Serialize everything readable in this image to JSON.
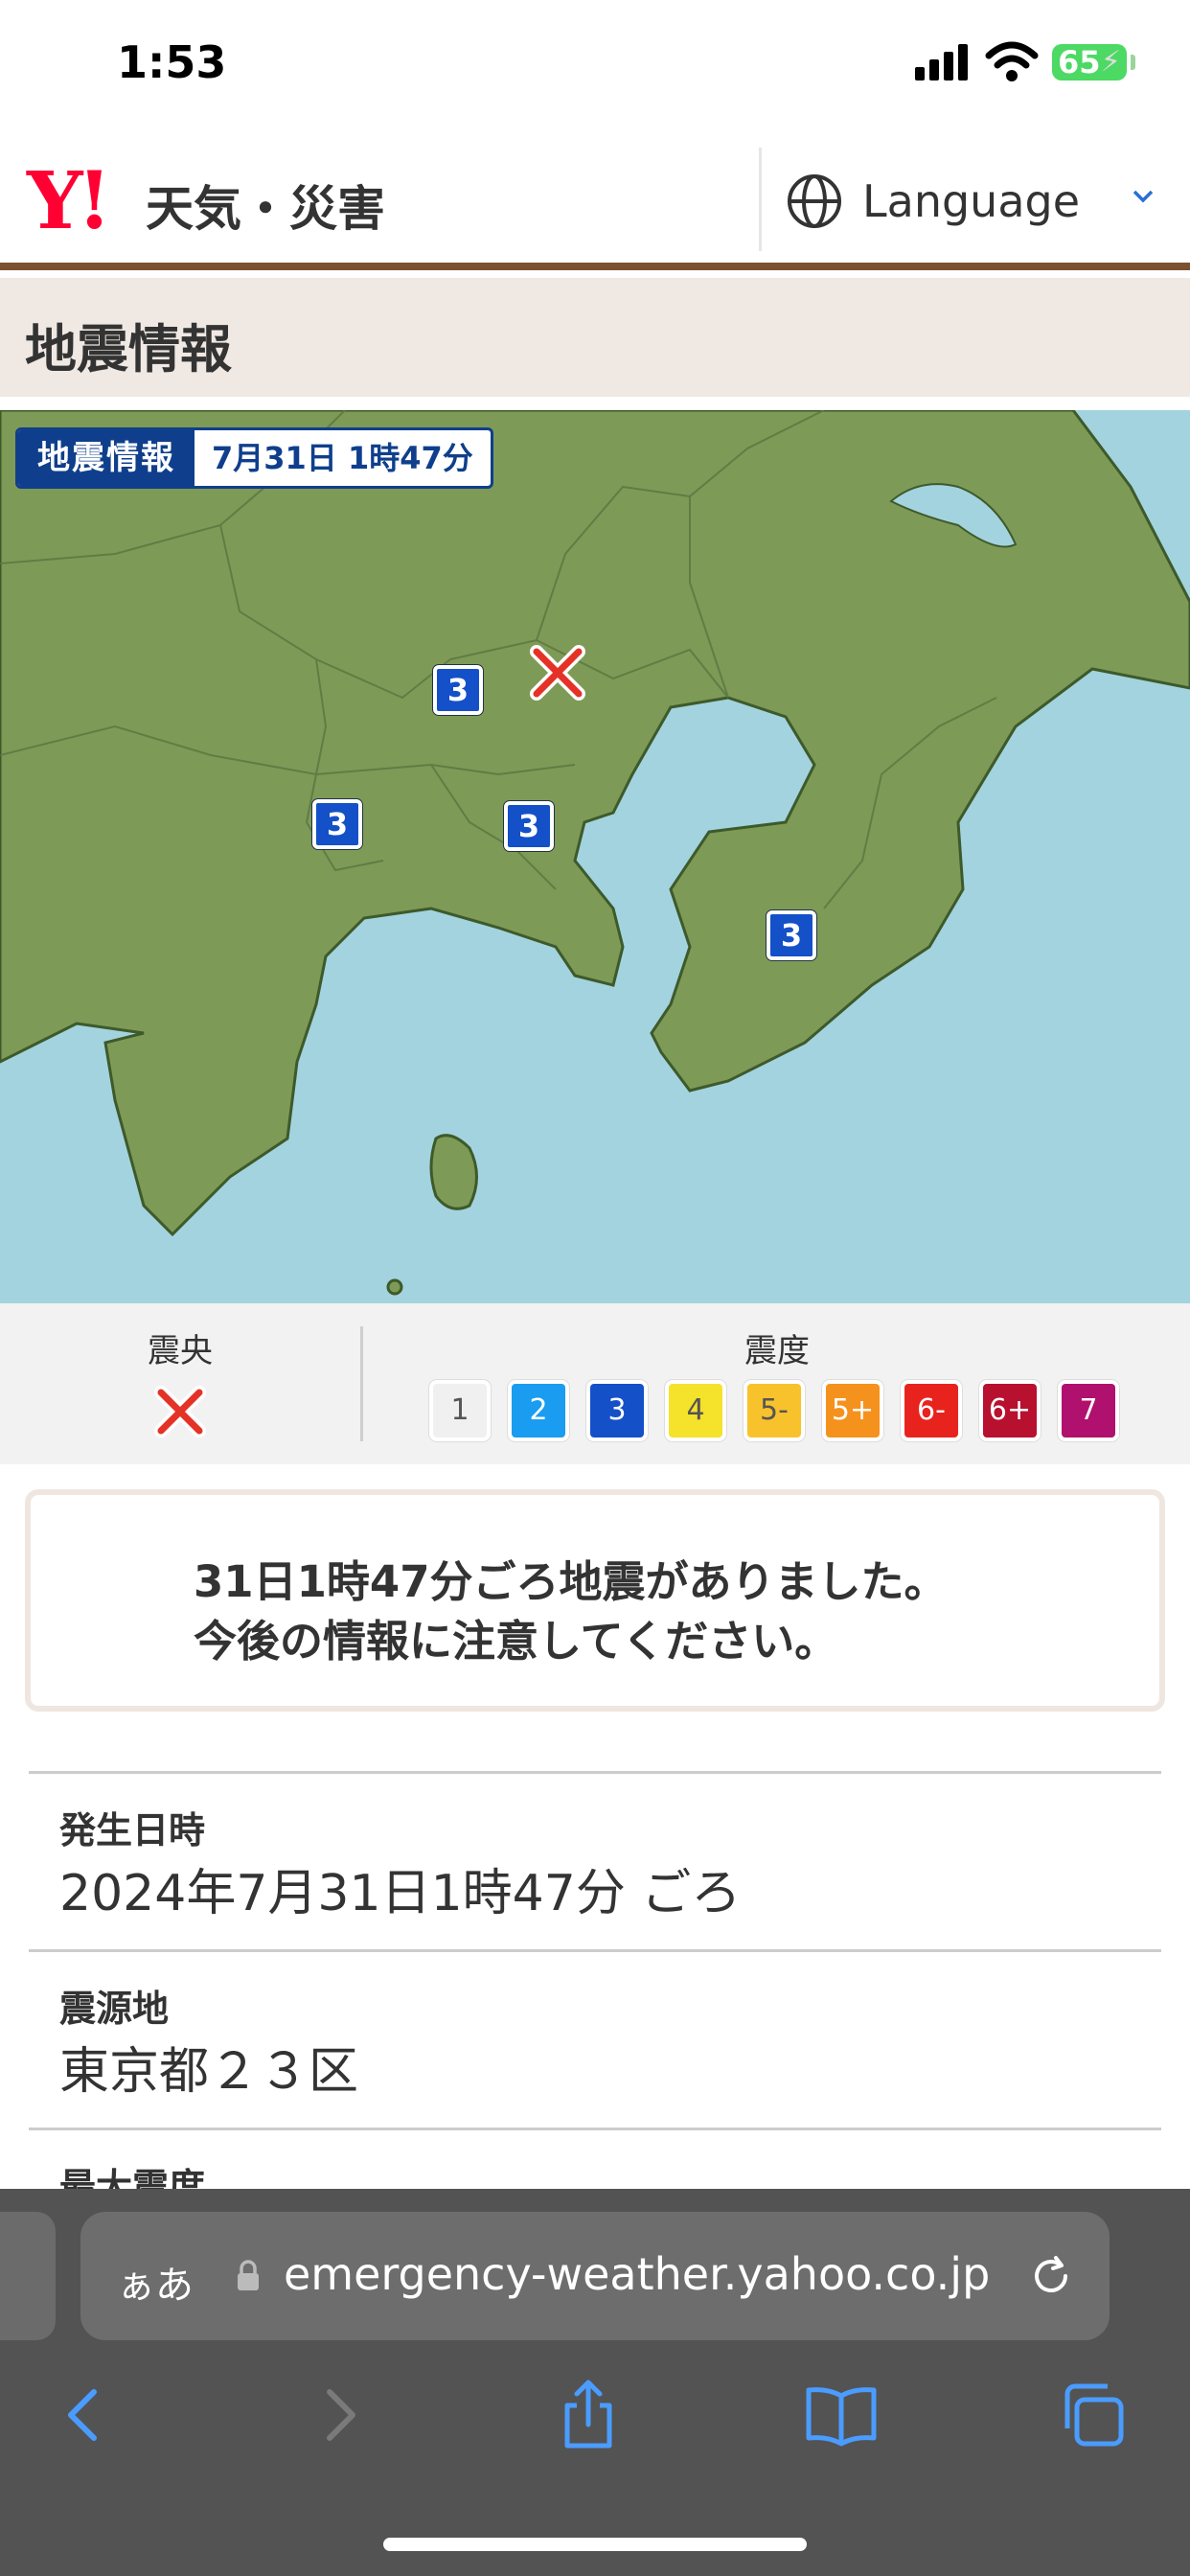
{
  "status_bar": {
    "time": "1:53",
    "battery": "65"
  },
  "header": {
    "logo_mark": "Y!",
    "logo_text": "天気・災害",
    "language_label": "Language"
  },
  "page": {
    "title": "地震情報"
  },
  "map": {
    "badge_label": "地震情報",
    "badge_datetime": "7月31日 1時47分",
    "intensity_markers": [
      "3",
      "3",
      "3",
      "3"
    ]
  },
  "legend": {
    "epicenter_label": "震央",
    "intensity_label": "震度",
    "scale": [
      {
        "label": "1",
        "color": "#f0f0f0",
        "text_color": "#555555"
      },
      {
        "label": "2",
        "color": "#1a9cf0",
        "text_color": "#ffffff"
      },
      {
        "label": "3",
        "color": "#1450c8",
        "text_color": "#ffffff"
      },
      {
        "label": "4",
        "color": "#f5e22a",
        "text_color": "#555555"
      },
      {
        "label": "5-",
        "color": "#f8c22c",
        "text_color": "#555555"
      },
      {
        "label": "5+",
        "color": "#f5921e",
        "text_color": "#ffffff"
      },
      {
        "label": "6-",
        "color": "#e8231e",
        "text_color": "#ffffff"
      },
      {
        "label": "6+",
        "color": "#b8102f",
        "text_color": "#ffffff"
      },
      {
        "label": "7",
        "color": "#b0106e",
        "text_color": "#ffffff"
      }
    ]
  },
  "notice": {
    "line1": "31日1時47分ごろ地震がありました。",
    "line2": "今後の情報に注意してください。"
  },
  "details": [
    {
      "label": "発生日時",
      "value": "2024年7月31日1時47分 ごろ"
    },
    {
      "label": "震源地",
      "value": "東京都２３区"
    },
    {
      "label": "最大震度",
      "value": ""
    }
  ],
  "browser": {
    "text_size_button": "ぁあ",
    "url": "emergency-weather.yahoo.co.jp"
  },
  "icons": {
    "globe": "globe-icon",
    "chevron": "chevron-down-icon",
    "lock": "lock-icon",
    "reload": "reload-icon",
    "back": "back-icon",
    "forward": "forward-icon",
    "share": "share-icon",
    "bookmarks": "bookmarks-icon",
    "tabs": "tabs-icon"
  }
}
